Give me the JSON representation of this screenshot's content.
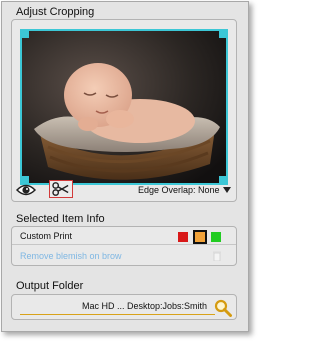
{
  "crop_section": {
    "title": "Adjust Cropping",
    "edge_overlap_label": "Edge Overlap: None",
    "frame_color": "#3cc7d6",
    "icons": {
      "preview": "eye-icon",
      "crop": "scissors-icon",
      "dropdown": "triangle-down-icon"
    }
  },
  "selected_info": {
    "title": "Selected Item Info",
    "custom_print_label": "Custom Print",
    "colors": [
      "#d81818",
      "#f2a33a",
      "#22cc22"
    ],
    "selected_color": "#f2a33a",
    "blemish_label": "Remove blemish on brow",
    "icons": {
      "delete": "trash-icon"
    }
  },
  "output_section": {
    "title": "Output Folder",
    "path": "Mac HD ... Desktop:Jobs:Smith",
    "icons": {
      "browse": "magnifier-icon"
    }
  }
}
